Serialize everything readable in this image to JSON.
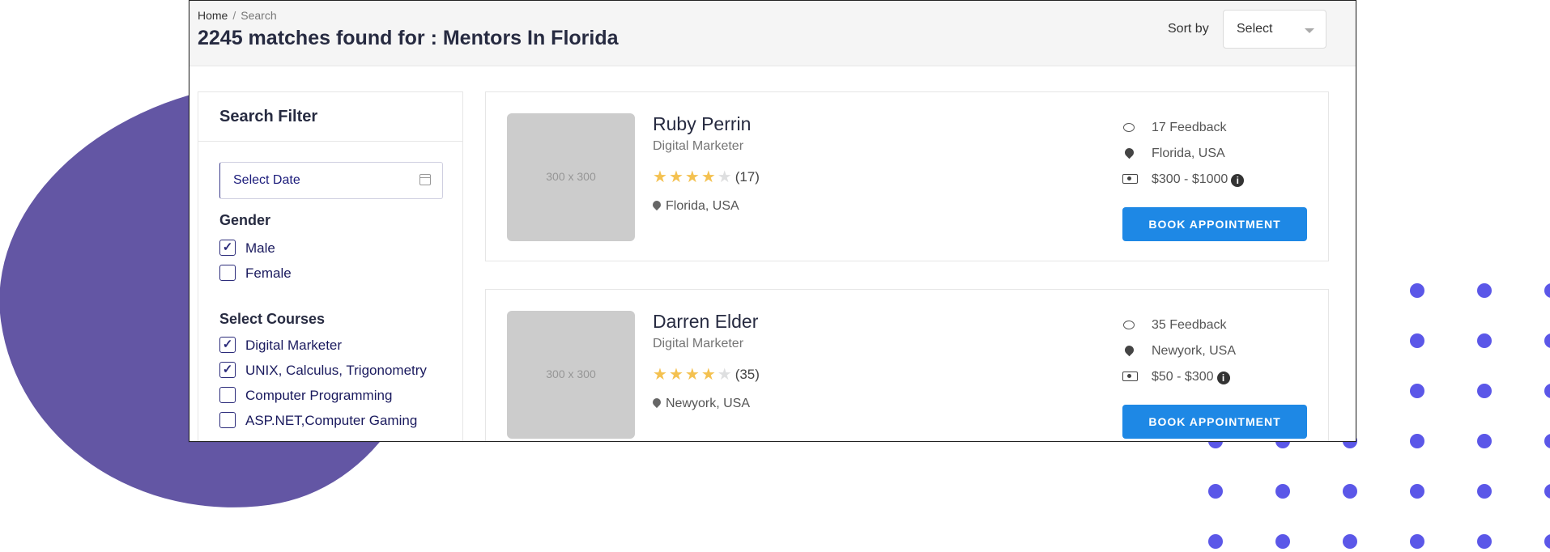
{
  "breadcrumb": {
    "home": "Home",
    "separator": "/",
    "current": "Search"
  },
  "page_title": "2245 matches found for : Mentors In Florida",
  "sort": {
    "label": "Sort by",
    "value": "Select"
  },
  "filter": {
    "title": "Search Filter",
    "date_value": "Select Date",
    "gender_title": "Gender",
    "genders": [
      {
        "label": "Male",
        "checked": true
      },
      {
        "label": "Female",
        "checked": false
      }
    ],
    "courses_title": "Select Courses",
    "courses": [
      {
        "label": "Digital Marketer",
        "checked": true
      },
      {
        "label": "UNIX, Calculus, Trigonometry",
        "checked": true
      },
      {
        "label": "Computer Programming",
        "checked": false
      },
      {
        "label": "ASP.NET,Computer Gaming",
        "checked": false
      }
    ]
  },
  "mentors": [
    {
      "photo_placeholder": "300 x 300",
      "name": "Ruby Perrin",
      "role": "Digital Marketer",
      "rating": 4,
      "review_count": "(17)",
      "location": "Florida, USA",
      "feedback": "17 Feedback",
      "info_location": "Florida, USA",
      "price": "$300 - $1000",
      "book_label": "BOOK APPOINTMENT"
    },
    {
      "photo_placeholder": "300 x 300",
      "name": "Darren Elder",
      "role": "Digital Marketer",
      "rating": 4,
      "review_count": "(35)",
      "location": "Newyork, USA",
      "feedback": "35 Feedback",
      "info_location": "Newyork, USA",
      "price": "$50 - $300",
      "book_label": "BOOK APPOINTMENT"
    }
  ],
  "colors": {
    "accent": "#1e88e5",
    "blob": "#6356a4",
    "dots": "#5b57e8",
    "star": "#f4c150"
  },
  "icons": {
    "date": "calendar-icon",
    "check": "check-icon",
    "feedback": "comment-icon",
    "location": "map-marker-icon",
    "price": "money-icon",
    "info": "info-circle-icon"
  }
}
